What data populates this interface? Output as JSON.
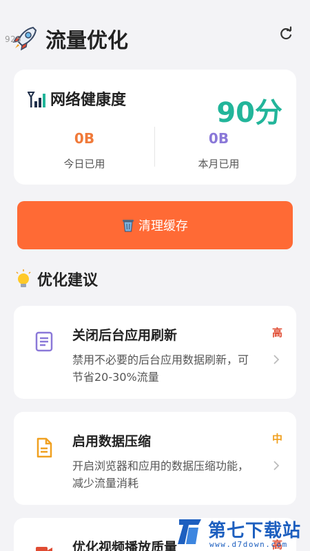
{
  "header": {
    "app_title": "流量优化",
    "logo_number": "925"
  },
  "health": {
    "title": "网络健康度",
    "score": "90分",
    "today": {
      "value": "0B",
      "label": "今日已用"
    },
    "month": {
      "value": "0B",
      "label": "本月已用"
    }
  },
  "clear_cache": {
    "label": "清理缓存"
  },
  "suggestions_section": {
    "title": "优化建议"
  },
  "suggestions": [
    {
      "title": "关闭后台应用刷新",
      "desc": "禁用不必要的后台应用数据刷新，可节省20-30%流量",
      "priority": "高"
    },
    {
      "title": "启用数据压缩",
      "desc": "开启浏览器和应用的数据压缩功能，减少流量消耗",
      "priority": "中"
    },
    {
      "title": "优化视频播放质量",
      "desc": "",
      "priority": "高"
    }
  ],
  "watermark": {
    "brand": "第七下载站",
    "url": "www.d7down.com"
  },
  "colors": {
    "accent_orange": "#ff6a35",
    "score_green": "#22b59a",
    "today_orange": "#f07a3a",
    "month_purple": "#8a78d8",
    "priority_high": "#e04c33",
    "priority_mid": "#f0a020"
  },
  "icons": {
    "logo": "rocket-icon",
    "refresh": "refresh-icon",
    "signal": "signal-bars-icon",
    "trash": "trash-icon",
    "bulb": "lightbulb-icon",
    "suggestion_1": "document-icon",
    "suggestion_2": "file-icon",
    "suggestion_3": "video-icon",
    "chevron": "chevron-right-icon"
  }
}
